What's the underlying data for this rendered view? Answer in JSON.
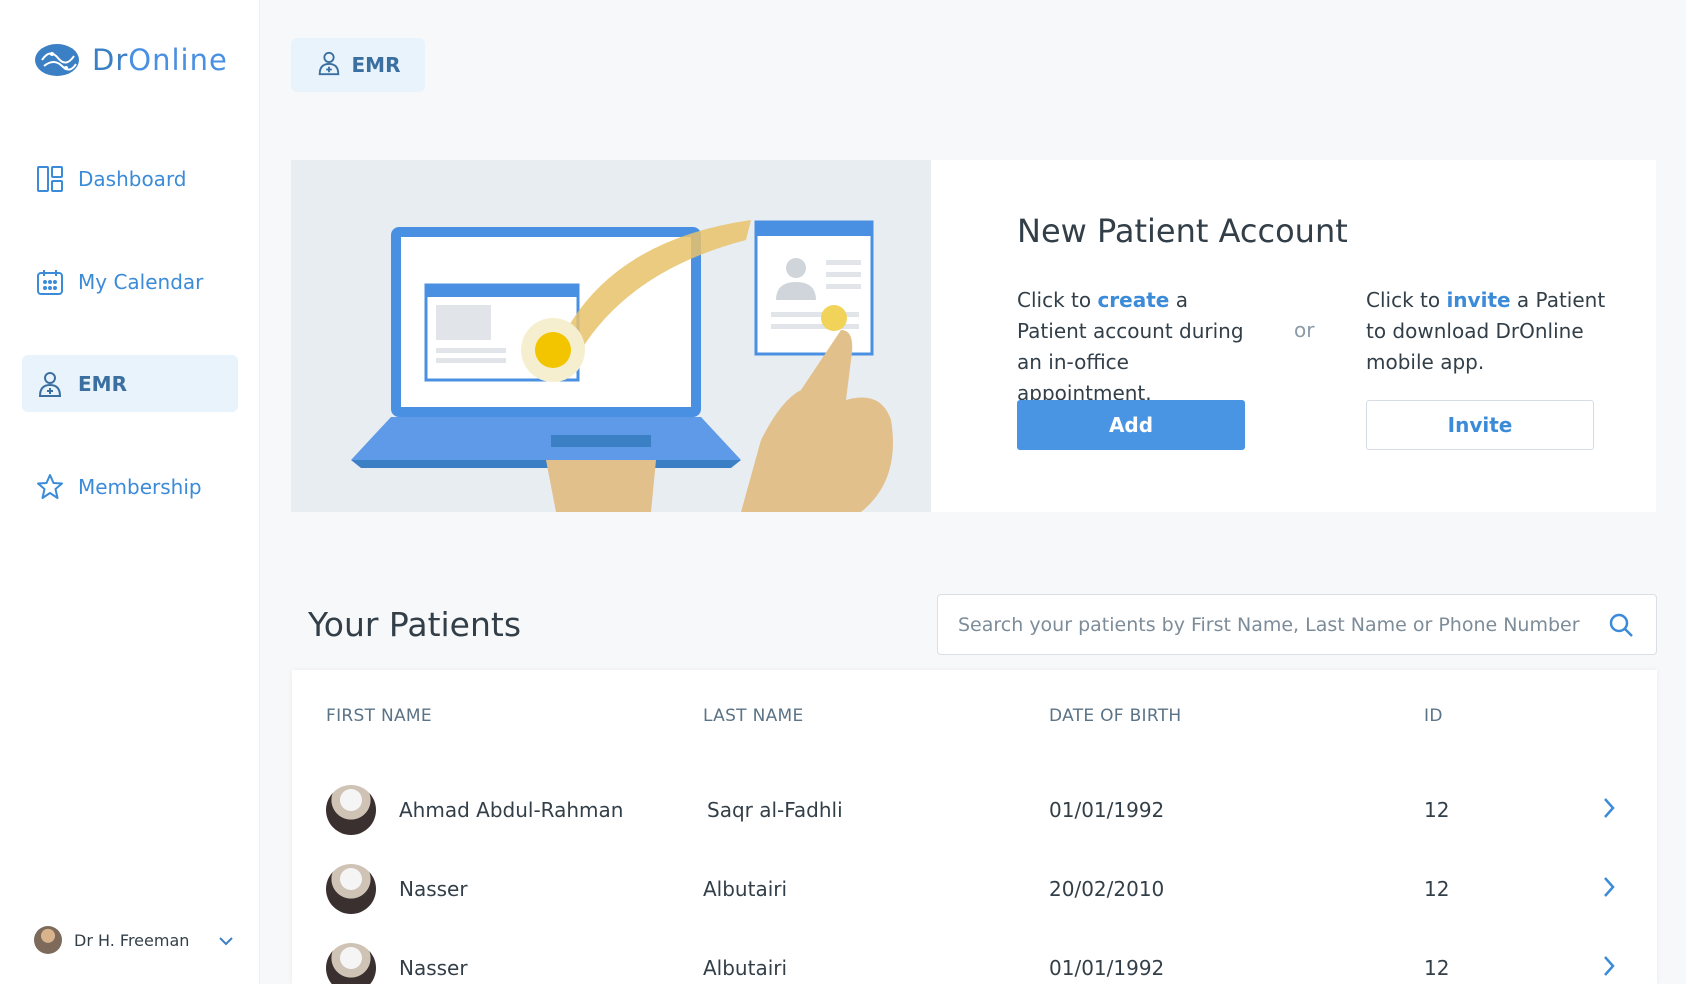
{
  "app": {
    "logo_prefix": "Dr",
    "logo_suffix": "Online"
  },
  "sidebar": {
    "items": [
      {
        "label": "Dashboard",
        "icon": "dashboard-icon"
      },
      {
        "label": "My Calendar",
        "icon": "calendar-icon"
      },
      {
        "label": "EMR",
        "icon": "patient-icon",
        "active": true
      },
      {
        "label": "Membership",
        "icon": "star-icon"
      }
    ],
    "user": {
      "name": "Dr H. Freeman"
    }
  },
  "header": {
    "tab_label": "EMR"
  },
  "hero": {
    "title": "New Patient Account",
    "create_prefix": "Click to ",
    "create_keyword": "create",
    "create_suffix": " a Patient account during an in-office appointment.",
    "or_label": "or",
    "invite_prefix": "Click to ",
    "invite_keyword": "invite",
    "invite_suffix": " a Patient to download DrOnline mobile app.",
    "add_label": "Add",
    "invite_label": "Invite"
  },
  "patients": {
    "title": "Your Patients",
    "search_placeholder": "Search your patients by First Name, Last Name or Phone Number",
    "columns": [
      "FIRST NAME",
      "LAST  NAME",
      "DATE OF BIRTH",
      "ID"
    ],
    "rows": [
      {
        "first": "Ahmad Abdul-Rahman",
        "last": "Saqr al-Fadhli",
        "dob": "01/01/1992",
        "id": "12"
      },
      {
        "first": "Nasser",
        "last": "Albutairi",
        "dob": "20/02/2010",
        "id": "12"
      },
      {
        "first": "Nasser",
        "last": "Albutairi",
        "dob": "01/01/1992",
        "id": "12"
      }
    ]
  },
  "colors": {
    "accent": "#4a95e3",
    "active_bg": "#e8f3fc",
    "text": "#333f48"
  }
}
